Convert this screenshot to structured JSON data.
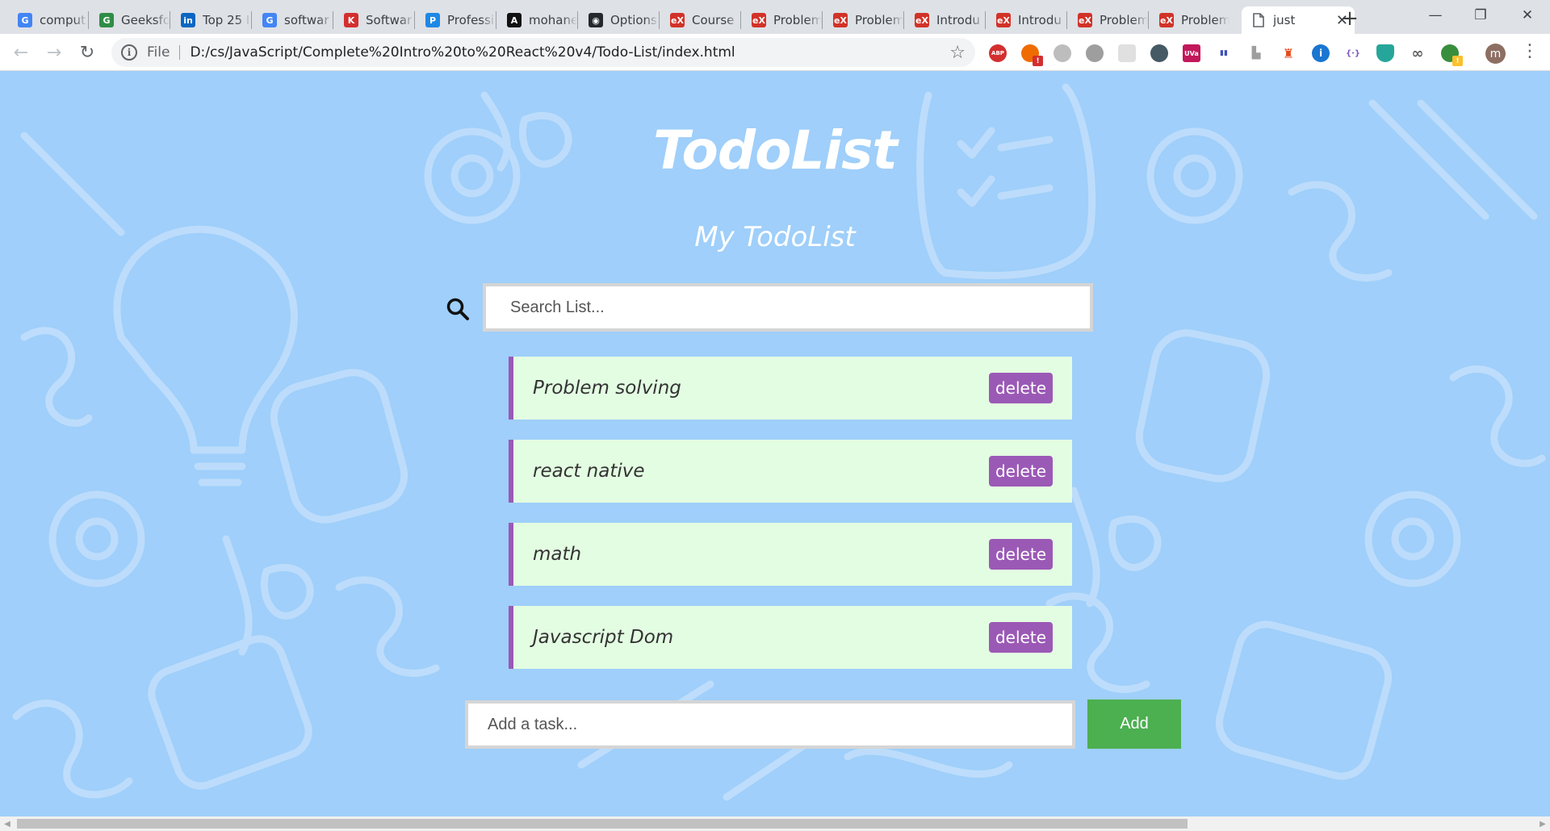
{
  "browser": {
    "tabs": [
      {
        "title": "comput",
        "icon": "google-icon",
        "color": "#4285f4",
        "glyph": "G"
      },
      {
        "title": "Geeksfo",
        "icon": "geeksforgeeks-icon",
        "color": "#2f8d46",
        "glyph": "G"
      },
      {
        "title": "Top 25 I",
        "icon": "linkedin-icon",
        "color": "#0a66c2",
        "glyph": "in"
      },
      {
        "title": "softwar",
        "icon": "google-icon",
        "color": "#4285f4",
        "glyph": "G"
      },
      {
        "title": "Softwar",
        "icon": "k-icon",
        "color": "#d32f2f",
        "glyph": "K"
      },
      {
        "title": "Professi",
        "icon": "p-icon",
        "color": "#1e88e5",
        "glyph": "P"
      },
      {
        "title": "mohane",
        "icon": "a-icon",
        "color": "#111111",
        "glyph": "A"
      },
      {
        "title": "Options",
        "icon": "github-icon",
        "color": "#24292e",
        "glyph": "◉"
      },
      {
        "title": "Course",
        "icon": "edx-icon",
        "color": "#d23228",
        "glyph": "eX"
      },
      {
        "title": "Problem",
        "icon": "edx-icon",
        "color": "#d23228",
        "glyph": "eX"
      },
      {
        "title": "Problem",
        "icon": "edx-icon",
        "color": "#d23228",
        "glyph": "eX"
      },
      {
        "title": "Introdu",
        "icon": "edx-icon",
        "color": "#d23228",
        "glyph": "eX"
      },
      {
        "title": "Introdu",
        "icon": "edx-icon",
        "color": "#d23228",
        "glyph": "eX"
      },
      {
        "title": "Problem",
        "icon": "edx-icon",
        "color": "#d23228",
        "glyph": "eX"
      },
      {
        "title": "Problem",
        "icon": "edx-icon",
        "color": "#d23228",
        "glyph": "eX"
      }
    ],
    "active_tab": {
      "title": "just",
      "icon": "page-icon"
    },
    "address": {
      "scheme_label": "File",
      "url": "D:/cs/JavaScript/Complete%20Intro%20to%20React%20v4/Todo-List/index.html"
    },
    "profile_initial": "m"
  },
  "app": {
    "title": "TodoList",
    "subtitle": "My TodoList",
    "search_placeholder": "Search List...",
    "todos": [
      {
        "text": "Problem solving",
        "delete_label": "delete"
      },
      {
        "text": "react native",
        "delete_label": "delete"
      },
      {
        "text": "math",
        "delete_label": "delete"
      },
      {
        "text": "Javascript Dom",
        "delete_label": "delete"
      }
    ],
    "add_placeholder": "Add a task...",
    "add_label": "Add"
  },
  "colors": {
    "background": "#9fcffa",
    "todo_bg": "#e3fde2",
    "accent_purple": "#9b59b6",
    "add_green": "#4caf50"
  }
}
